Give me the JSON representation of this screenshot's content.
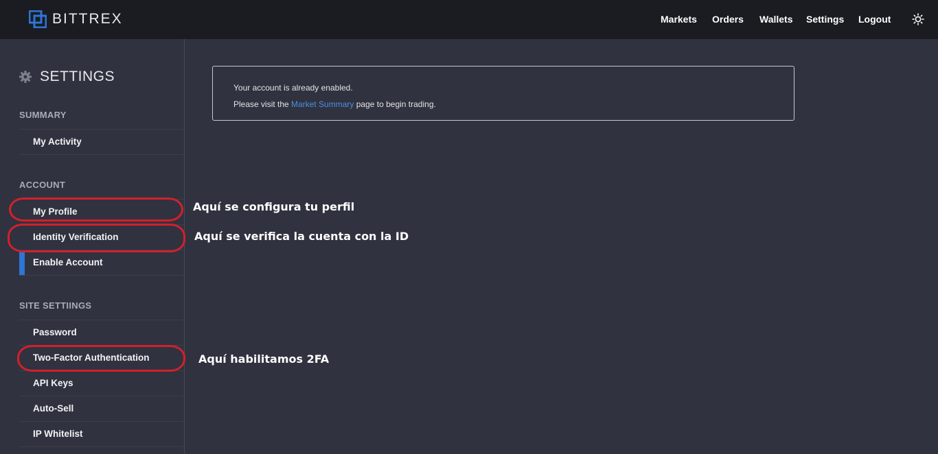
{
  "brand": {
    "name": "BITTREX",
    "logo_icon": "bittrex-logo-icon",
    "color": "#2e75d6"
  },
  "nav": {
    "markets": "Markets",
    "orders": "Orders",
    "wallets": "Wallets",
    "settings": "Settings",
    "logout": "Logout",
    "theme_icon": "sun-icon"
  },
  "sidebar": {
    "title": "SETTINGS",
    "title_icon": "gear-icon",
    "sections": {
      "summary": {
        "heading": "SUMMARY",
        "items": [
          "My Activity"
        ]
      },
      "account": {
        "heading": "ACCOUNT",
        "items": [
          "My Profile",
          "Identity Verification",
          "Enable Account"
        ]
      },
      "site": {
        "heading": "SITE SETTIINGS",
        "items": [
          "Password",
          "Two-Factor Authentication",
          "API Keys",
          "Auto-Sell",
          "IP Whitelist"
        ]
      }
    },
    "active_item": "Enable Account"
  },
  "notice": {
    "line1": "Your account is already enabled.",
    "line2_pre": "Please visit the ",
    "line2_link": "Market Summary",
    "line2_post": " page to begin trading."
  },
  "annotations": {
    "profile": "Aquí se configura tu perfil",
    "identity": "Aquí se verifica la cuenta con la ID",
    "twofa": "Aquí habilitamos 2FA",
    "ring_color": "#d3202b"
  }
}
